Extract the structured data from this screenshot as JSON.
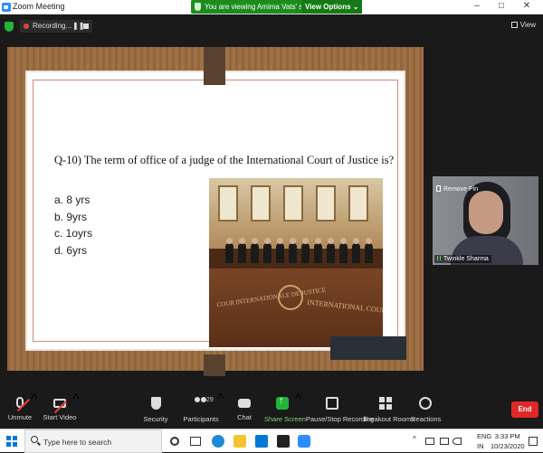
{
  "window": {
    "title": "Zoom Meeting",
    "minimize_glyph": "–",
    "restore_glyph": "□",
    "close_glyph": "✕"
  },
  "banner": {
    "message": "You are viewing Amima Vats' screen",
    "view_options_label": "View Options ⌄"
  },
  "recording": {
    "label": "Recording...",
    "pause_glyph": "❚❚"
  },
  "view_button": {
    "label": "View"
  },
  "slide": {
    "question": "Q-10) The term of office of a judge of the International Court of Justice is?",
    "options": [
      "a. 8 yrs",
      "b. 9yrs",
      "c. 1oyrs",
      "d. 6yrs"
    ],
    "photo_text_left": "COUR INTERNATIONALE DE JUSTICE",
    "photo_text_right": "INTERNATIONAL COURT OF JUSTICE"
  },
  "participant": {
    "remove_pin_label": "Remove Pin",
    "name": "Twinkle Sharma"
  },
  "toolbar": {
    "unmute": "Unmute",
    "start_video": "Start Video",
    "security": "Security",
    "participants": "Participants",
    "participants_count": "29",
    "chat": "Chat",
    "share_screen": "Share Screen",
    "pause_stop_recording": "Pause/Stop Recording",
    "breakout_rooms": "Breakout Rooms",
    "reactions": "Reactions",
    "end": "End",
    "caret": "^"
  },
  "taskbar": {
    "search_placeholder": "Type here to search",
    "language_top": "ENG",
    "language_bottom": "IN",
    "time": "3:33 PM",
    "date": "10/23/2020"
  },
  "colors": {
    "accent_green": "#23b33a",
    "end_red": "#e02828",
    "zoom_blue": "#2d8cff"
  }
}
